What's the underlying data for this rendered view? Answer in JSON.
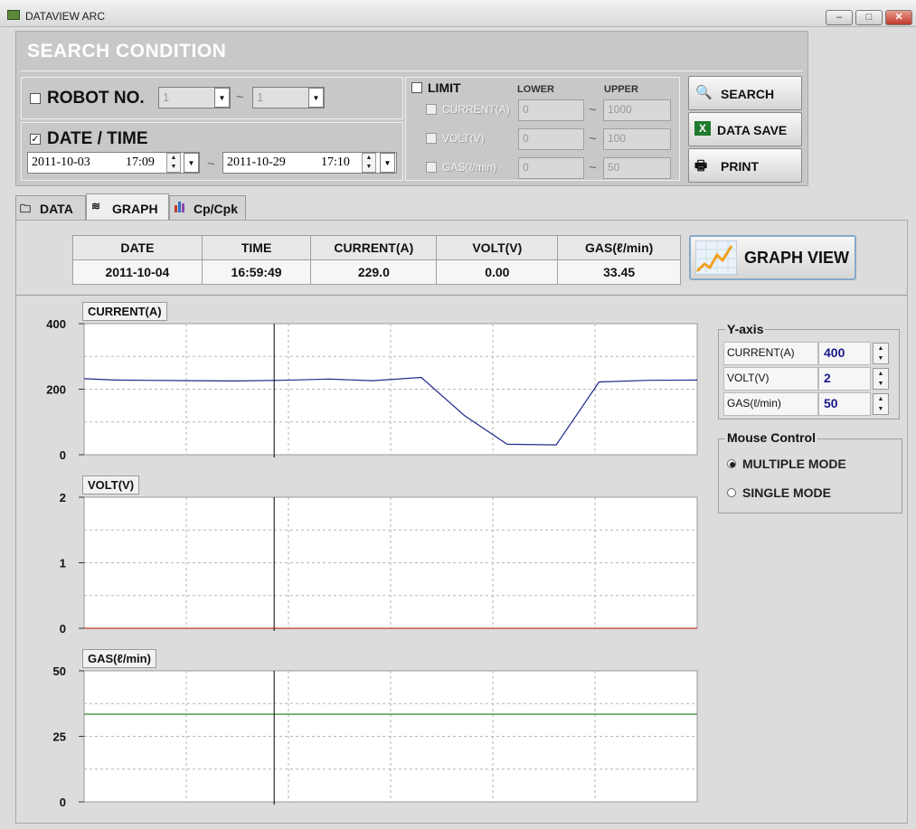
{
  "window": {
    "title": "DATAVIEW ARC",
    "minimize": "–",
    "maximize": "□",
    "close": "✕"
  },
  "search": {
    "title": "SEARCH CONDITION",
    "robot": {
      "label": "ROBOT NO.",
      "checked": false,
      "from": "1",
      "to": "1",
      "tilde": "~"
    },
    "datetime": {
      "label": "DATE / TIME",
      "checked": true,
      "from_date": "2011-10-03",
      "from_time": "17:09",
      "to_date": "2011-10-29",
      "to_time": "17:10",
      "tilde": "~"
    },
    "limit": {
      "label": "LIMIT",
      "checked": false,
      "lower_header": "LOWER",
      "upper_header": "UPPER",
      "rows": [
        {
          "label": "CURRENT(A)",
          "lower": "0",
          "upper": "1000"
        },
        {
          "label": "VOLT(V)",
          "lower": "0",
          "upper": "100"
        },
        {
          "label": "GAS(ℓ/min)",
          "lower": "0",
          "upper": "50"
        }
      ]
    },
    "buttons": {
      "search": "SEARCH",
      "data_save": "DATA SAVE",
      "print": "PRINT"
    }
  },
  "tabs": [
    {
      "label": "DATA",
      "active": false
    },
    {
      "label": "GRAPH",
      "active": true
    },
    {
      "label": "Cp/Cpk",
      "active": false
    }
  ],
  "info_table": {
    "headers": [
      "DATE",
      "TIME",
      "CURRENT(A)",
      "VOLT(V)",
      "GAS(ℓ/min)"
    ],
    "values": [
      "2011-10-04",
      "16:59:49",
      "229.0",
      "0.00",
      "33.45"
    ]
  },
  "graph_view_button": "GRAPH VIEW",
  "yaxis_panel": {
    "title": "Y-axis",
    "rows": [
      {
        "label": "CURRENT(A)",
        "value": "400"
      },
      {
        "label": "VOLT(V)",
        "value": "2"
      },
      {
        "label": "GAS(ℓ/min)",
        "value": "50"
      }
    ]
  },
  "mouse_control": {
    "title": "Mouse Control",
    "options": [
      {
        "label": "MULTIPLE MODE",
        "selected": true
      },
      {
        "label": "SINGLE MODE",
        "selected": false
      }
    ]
  },
  "colors": {
    "current_line": "#1f2a8c",
    "volt_line": "#c0392b",
    "gas_line": "#2e8b2e",
    "cursor_line": "#000000"
  },
  "chart_data": [
    {
      "type": "line",
      "title": "CURRENT(A)",
      "ylim": [
        0,
        400
      ],
      "yticks": [
        "400",
        "200",
        "0"
      ],
      "x": [
        0,
        5,
        10,
        18,
        25,
        32,
        40,
        47,
        55,
        62,
        69,
        77,
        84,
        92,
        100
      ],
      "series": [
        {
          "values": [
            232,
            228,
            227,
            226,
            225,
            227,
            231,
            226,
            236,
            120,
            32,
            30,
            222,
            227,
            228
          ]
        }
      ],
      "cursor_x": 31
    },
    {
      "type": "line",
      "title": "VOLT(V)",
      "ylim": [
        0,
        2
      ],
      "yticks": [
        "2",
        "1",
        "0"
      ],
      "x": [
        0,
        100
      ],
      "series": [
        {
          "values": [
            0,
            0
          ]
        }
      ],
      "cursor_x": 31
    },
    {
      "type": "line",
      "title": "GAS(ℓ/min)",
      "ylim": [
        0,
        50
      ],
      "yticks": [
        "50",
        "25",
        "0"
      ],
      "x": [
        0,
        100
      ],
      "series": [
        {
          "values": [
            33.45,
            33.45
          ]
        }
      ],
      "cursor_x": 31
    }
  ]
}
